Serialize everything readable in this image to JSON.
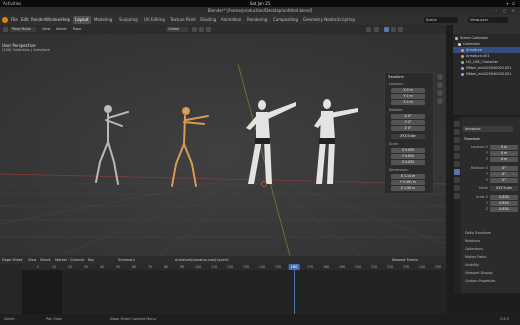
{
  "system_bar": {
    "activities": "Activities",
    "clock": "Sat Jan 25",
    "tray": "▾ ⏻"
  },
  "window": {
    "title": "Blender* [/home/production/Desktop/untitled.blend]",
    "controls": "– ▢ ✕"
  },
  "menu": {
    "items": [
      "File",
      "Edit",
      "Render",
      "Window",
      "Help"
    ],
    "tabs": [
      "Layout",
      "Modeling",
      "Sculpting",
      "UV Editing",
      "Texture Paint",
      "Shading",
      "Animation",
      "Rendering",
      "Compositing",
      "Geometry Nodes",
      "Scripting"
    ],
    "active_tab": "Layout",
    "scene": "Scene",
    "view_layer": "ViewLayer"
  },
  "viewport_header": {
    "mode": "Pose Mode",
    "view": "View",
    "select": "Select",
    "pose": "Pose",
    "transform": "Global"
  },
  "viewport": {
    "view_name": "User Perspective",
    "collection": "(150) Collection | Armature"
  },
  "n_panel": {
    "transform_title": "Transform",
    "location_label": "Location:",
    "location": [
      "X  0 m",
      "Y  0 m",
      "Z  0 m"
    ],
    "rotation_label": "Rotation:",
    "rotation": [
      "X  0°",
      "Y  0°",
      "Z  0°"
    ],
    "rotation_mode": "XYZ Euler",
    "scale_label": "Scale:",
    "scale": [
      "X  0.830",
      "Y  0.830",
      "Z  0.830"
    ],
    "dimensions_label": "Dimensions:",
    "dimensions": [
      "X  1.14 m",
      "Y  0.491 m",
      "Z  1.98 m"
    ]
  },
  "outliner": {
    "rows": [
      {
        "label": "Scene Collection",
        "selected": false,
        "color": "#bbbbbb"
      },
      {
        "label": "Collection",
        "selected": false,
        "color": "#dddddd"
      },
      {
        "label": "Armature",
        "selected": true,
        "color": "#e0a050"
      },
      {
        "label": "Armature.001",
        "selected": false,
        "color": "#e0a050"
      },
      {
        "label": "HG_LHB_Character",
        "selected": false,
        "color": "#88bb88"
      },
      {
        "label": "HBbel_zic0425040029.001",
        "selected": false,
        "color": "#88aaee"
      },
      {
        "label": "HBbel_zic0425040030.001",
        "selected": false,
        "color": "#88aaee"
      }
    ]
  },
  "properties": {
    "object_name": "Armature",
    "transform_title": "Transform",
    "location_label": "Location X",
    "location": [
      "0 m",
      "0 m",
      "0 m"
    ],
    "location_axes": [
      "Y",
      "Z"
    ],
    "rotation_label": "Rotation X",
    "rotation": [
      "0°",
      "0°",
      "0°"
    ],
    "rotation_axes": [
      "Y",
      "Z"
    ],
    "mode_label": "Mode",
    "mode": "XYZ Euler",
    "scale_label": "Scale X",
    "scale": [
      "0.830",
      "0.830",
      "0.830"
    ],
    "scale_axes": [
      "Y",
      "Z"
    ],
    "subsections": [
      "Delta Transform",
      "Relations",
      "Collections",
      "Motion Paths",
      "Visibility",
      "Viewport Display",
      "Custom Properties"
    ]
  },
  "timeline": {
    "header": [
      "Dope Sheet",
      "View",
      "Select",
      "Marker",
      "Channel",
      "Key"
    ],
    "summary": "Summary",
    "action": "Armature|mixamo.com|Layer0",
    "interpolation": "Nearest Frame",
    "ticks": [
      0,
      10,
      20,
      30,
      40,
      50,
      60,
      70,
      80,
      90,
      100,
      110,
      120,
      130,
      140,
      150,
      160,
      170,
      180,
      190,
      200,
      210,
      220,
      230,
      240,
      250
    ],
    "current_frame": 160
  },
  "status_bar": {
    "select": "Select",
    "pan_view": "Pan View",
    "context_menu": "Dope Sheet Context Menu",
    "version": "3.6.5"
  }
}
